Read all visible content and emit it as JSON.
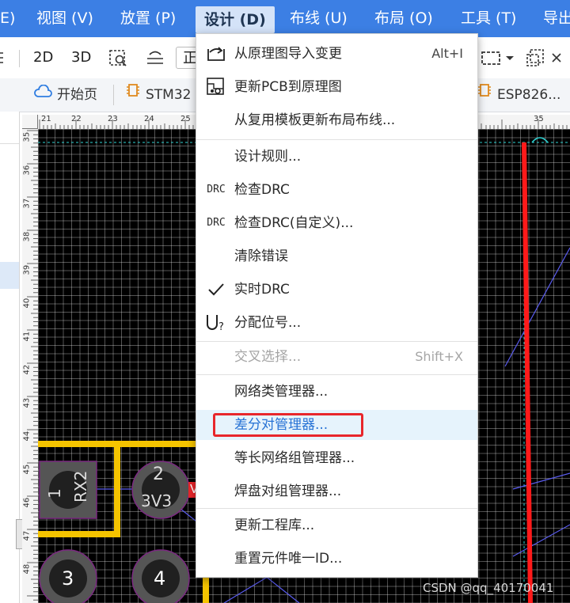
{
  "menubar": {
    "items": [
      "E)",
      "视图 (V)",
      "放置 (P)",
      "设计 (D)",
      "布线 (U)",
      "布局 (O)",
      "工具 (T)",
      "导出"
    ],
    "active_index": 3
  },
  "toolbar": {
    "view_2d": "2D",
    "view_3d": "3D",
    "trunc_text": "正"
  },
  "tabs": {
    "items": [
      "开始页",
      "STM32",
      "ESP826..."
    ]
  },
  "ruler": {
    "top_labels": [
      "21",
      "22",
      "23",
      "24",
      "25",
      "35"
    ],
    "left_labels": [
      "35",
      "36",
      "37",
      "38",
      "39",
      "40",
      "41",
      "42",
      "43",
      "44",
      "45",
      "46",
      "47",
      "48"
    ]
  },
  "pcb": {
    "pads": [
      {
        "number": "1",
        "net": "RX2"
      },
      {
        "number": "2",
        "net": "3V3"
      },
      {
        "number": "3"
      },
      {
        "number": "4"
      }
    ],
    "net_fragment": "V"
  },
  "design_menu": {
    "items": [
      {
        "label": "从原理图导入变更",
        "shortcut": "Alt+I",
        "icon": "import-icon"
      },
      {
        "label": "更新PCB到原理图",
        "icon": "update-schematic-icon"
      },
      {
        "label": "从复用模板更新布局布线..."
      },
      {
        "label": "设计规则..."
      },
      {
        "label": "检查DRC",
        "icon_text": "DRC"
      },
      {
        "label": "检查DRC(自定义)...",
        "icon_text": "DRC"
      },
      {
        "label": "清除错误"
      },
      {
        "label": "实时DRC",
        "checked": true,
        "icon": "check-icon"
      },
      {
        "label": "分配位号...",
        "icon": "assign-designator-icon"
      },
      {
        "label": "交叉选择...",
        "shortcut": "Shift+X",
        "disabled": true
      },
      {
        "label": "网络类管理器..."
      },
      {
        "label": "差分对管理器...",
        "highlighted": true
      },
      {
        "label": "等长网络组管理器..."
      },
      {
        "label": "焊盘对组管理器..."
      },
      {
        "label": "更新工程库..."
      },
      {
        "label": "重置元件唯一ID..."
      }
    ]
  },
  "watermark": "CSDN @qq_40170041",
  "colors": {
    "menubar_bg": "#3c7fe4",
    "highlight_red": "#e8262b",
    "hover_bg": "#e6f3fc",
    "pcb_bg": "#000000",
    "track_yellow": "#f5c400",
    "track_red": "#ff1a1a",
    "ratsnest_blue": "#5a5cf0"
  }
}
